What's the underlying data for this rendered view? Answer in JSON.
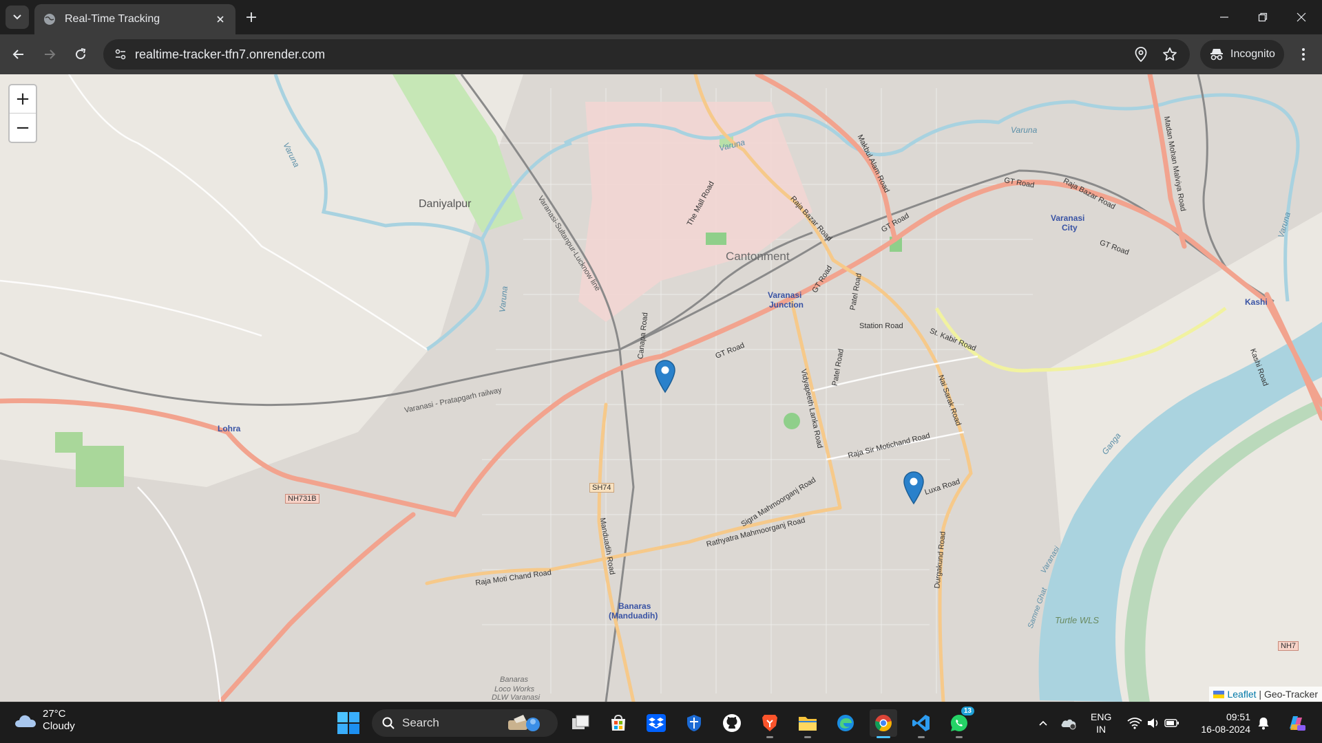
{
  "browser": {
    "tab_title": "Real-Time Tracking",
    "url": "realtime-tracker-tfn7.onrender.com",
    "incognito_label": "Incognito"
  },
  "map": {
    "zoom_in_label": "+",
    "zoom_out_label": "−",
    "attribution_link": "Leaflet",
    "attribution_separator": " | ",
    "attribution_text": "Geo-Tracker",
    "place_labels": {
      "daniyalpur": "Daniyalpur",
      "cantonment": "Cantonment",
      "varanasi_junction_1": "Varanasi",
      "varanasi_junction_2": "Junction",
      "varanasi_city_1": "Varanasi",
      "varanasi_city_2": "City",
      "kashi": "Kashi",
      "lohra": "Lohra",
      "banaras_1": "Banaras",
      "banaras_2": "(Manduadih)",
      "loco_1": "Banaras",
      "loco_2": "Loco Works",
      "loco_3": "DLW Varanasi",
      "turtle": "Turtle WLS",
      "ganga": "Ganga"
    },
    "road_labels": {
      "gt_road_1": "GT Road",
      "gt_road_2": "GT Road",
      "gt_road_3": "GT Road",
      "gt_road_4": "GT Road",
      "gt_road_5": "GT Road",
      "raja_bazar_road": "Raja Bazar Road",
      "raja_bazar_road_2": "Raja Bazar Road",
      "the_mall_road": "The Mall Road",
      "makbul_alam_road": "Makbul Alam Road",
      "madan_mohan": "Madan Mohan Malviya Road",
      "station_road": "Station Road",
      "st_kabir_road": "St. Kabir Road",
      "patel_road": "Patel Road",
      "patel_road_2": "Patel Road",
      "vidyapeeth": "Vidyapeeth Lanka Road",
      "nai_sarak": "Nai Sarak Road",
      "raja_sir_motichand": "Raja Sir Motichand Road",
      "luxa_road": "Luxa Road",
      "sigra": "Sigra Mahmoorganj Road",
      "rathyatra": "Rathyatra Mahmoorganj Road",
      "raja_moti_chand": "Raja Moti Chand Road",
      "manduadih_road": "Manduadih Road",
      "durgakund": "Durgakund Road",
      "varanasi_sultanpur": "Varanasi-Sultanpur-Lucknow line",
      "varanasi_pratapgarh": "Varanasi - Pratapgarh railway",
      "canapa": "Canapa Road",
      "varuna_1": "Varuna",
      "varuna_2": "Varuna",
      "varuna_3": "Varuna",
      "varuna_4": "Varuna",
      "varuna_5": "Varuna",
      "sh74": "SH74",
      "nh731b": "NH731B",
      "nh7": "NH7",
      "kashi_road": "Kashi Road",
      "samne": "Samne Ghat",
      "varanasi_river": "Varanasi"
    }
  },
  "taskbar": {
    "weather_temp": "27°C",
    "weather_desc": "Cloudy",
    "search_label": "Search",
    "whatsapp_badge": "13",
    "lang_1": "ENG",
    "lang_2": "IN",
    "time": "09:51",
    "date": "16-08-2024"
  }
}
